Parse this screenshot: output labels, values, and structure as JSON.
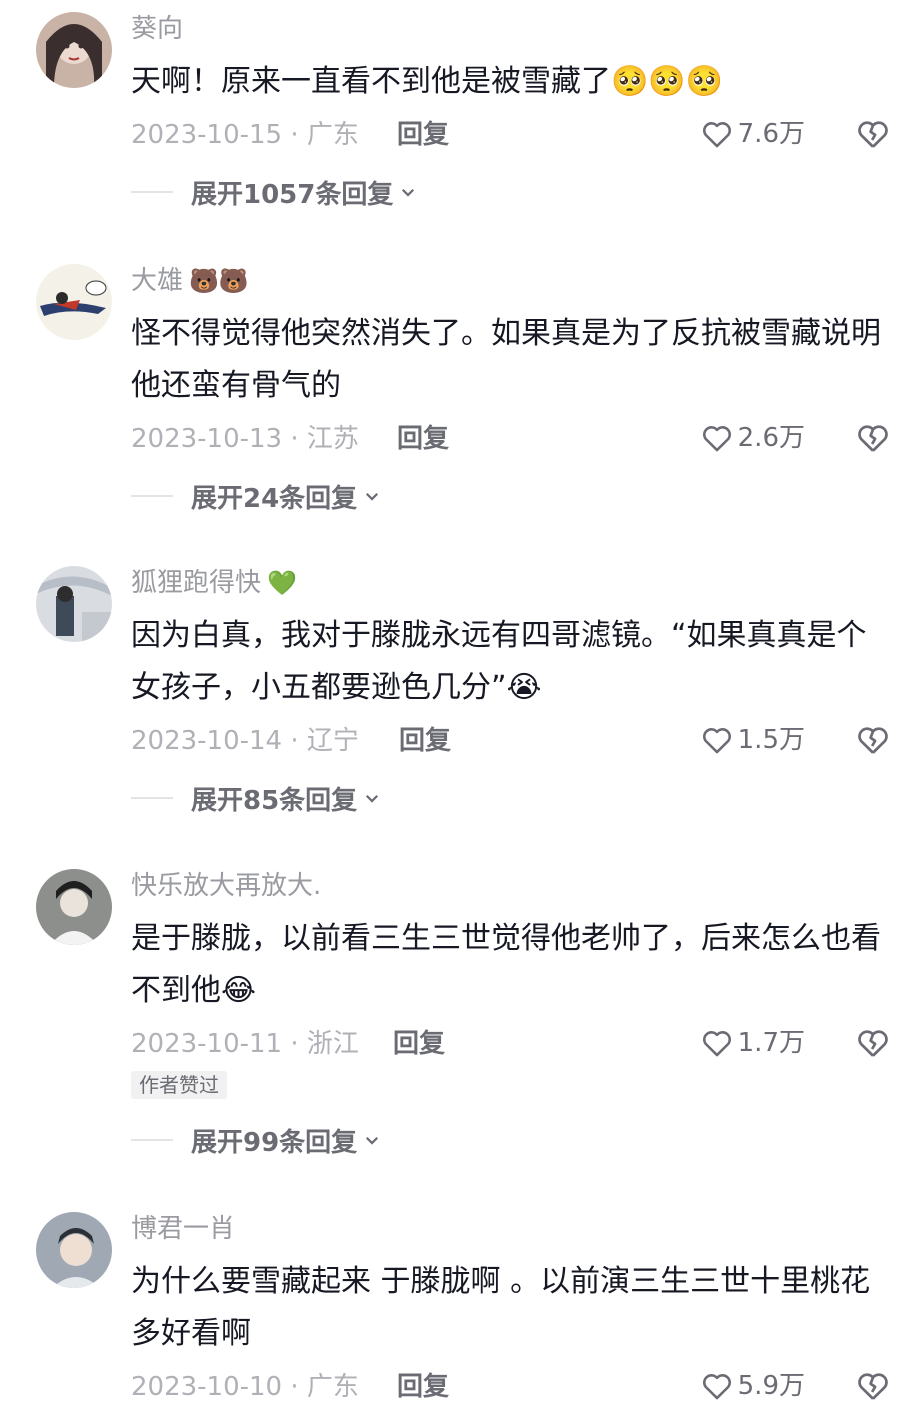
{
  "comments": [
    {
      "user": "葵向",
      "user_emoji": "",
      "text": "天啊！原来一直看不到他是被雪藏了🥺🥺🥺",
      "date_location": "2023-10-15 · 广东",
      "reply_label": "回复",
      "likes": "7.6万",
      "badge": "",
      "expand_label": "展开1057条回复",
      "avatar_colors": [
        "#c9b2a6",
        "#3b2e2e"
      ]
    },
    {
      "user": "大雄",
      "user_emoji": "🐻🐻",
      "text": "怪不得觉得他突然消失了。如果真是为了反抗被雪藏说明他还蛮有骨气的",
      "date_location": "2023-10-13 · 江苏",
      "reply_label": "回复",
      "likes": "2.6万",
      "badge": "",
      "expand_label": "展开24条回复",
      "avatar_colors": [
        "#f4f1e8",
        "#2d3f6e"
      ]
    },
    {
      "user": "狐狸跑得快",
      "user_emoji": "💚",
      "text": "因为白真，我对于滕胧永远有四哥滤镜。“如果真真是个女孩子，小五都要逊色几分”😭",
      "date_location": "2023-10-14 · 辽宁",
      "reply_label": "回复",
      "likes": "1.5万",
      "badge": "",
      "expand_label": "展开85条回复",
      "avatar_colors": [
        "#d9dde2",
        "#3e4a57"
      ]
    },
    {
      "user": "快乐放大再放大.",
      "user_emoji": "",
      "text": "是于滕胧，以前看三生三世觉得他老帅了，后来怎么也看不到他😂",
      "date_location": "2023-10-11 · 浙江",
      "reply_label": "回复",
      "likes": "1.7万",
      "badge": "作者赞过",
      "expand_label": "展开99条回复",
      "avatar_colors": [
        "#8d8f8c",
        "#e9e3dc"
      ]
    },
    {
      "user": "博君一肖",
      "user_emoji": "",
      "text": "为什么要雪藏起来 于滕胧啊 。以前演三生三世十里桃花多好看啊",
      "date_location": "2023-10-10 · 广东",
      "reply_label": "回复",
      "likes": "5.9万",
      "badge": "",
      "expand_label": "",
      "avatar_colors": [
        "#9fa8b3",
        "#2b2f36"
      ]
    }
  ],
  "icons": {
    "like": "heart-outline-icon",
    "dislike": "broken-heart-icon",
    "expand": "chevron-down-icon"
  },
  "colors": {
    "name": "#9a9ba1",
    "text": "#161823",
    "meta": "#b0b1b6",
    "action": "#6a6b73"
  }
}
